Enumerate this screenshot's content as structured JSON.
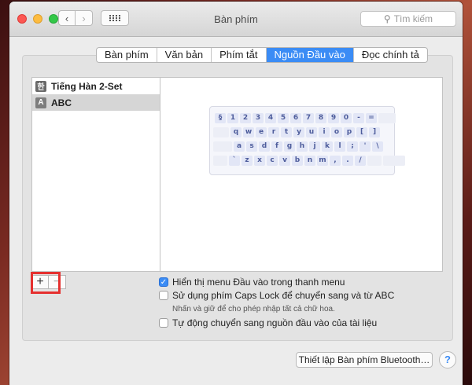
{
  "window": {
    "title": "Bàn phím"
  },
  "toolbar": {
    "back_glyph": "‹",
    "forward_glyph": "›",
    "search_placeholder": "Tìm kiếm"
  },
  "tabs": [
    {
      "label": "Bàn phím"
    },
    {
      "label": "Văn bản"
    },
    {
      "label": "Phím tắt"
    },
    {
      "label": "Nguồn Đầu vào",
      "active": true
    },
    {
      "label": "Đọc chính tả"
    }
  ],
  "sources": [
    {
      "icon_char": "한",
      "label": "Tiếng Hàn 2-Set"
    },
    {
      "icon_char": "A",
      "label": "ABC",
      "selected": true
    }
  ],
  "keyboard": {
    "rows": [
      [
        "§",
        "1",
        "2",
        "3",
        "4",
        "5",
        "6",
        "7",
        "8",
        "9",
        "0",
        "-",
        "=",
        ""
      ],
      [
        "",
        "q",
        "w",
        "e",
        "r",
        "t",
        "y",
        "u",
        "i",
        "o",
        "p",
        "[",
        "]"
      ],
      [
        "",
        "a",
        "s",
        "d",
        "f",
        "g",
        "h",
        "j",
        "k",
        "l",
        ";",
        "'",
        "\\"
      ],
      [
        "",
        "`",
        "z",
        "x",
        "c",
        "v",
        "b",
        "n",
        "m",
        ",",
        ".",
        "/",
        "",
        ""
      ]
    ]
  },
  "buttons": {
    "add": "+",
    "remove": "−",
    "bluetooth": "Thiết lập Bàn phím Bluetooth…",
    "help": "?"
  },
  "options": {
    "show_menu": {
      "label": "Hiển thị menu Đầu vào trong thanh menu",
      "checked": true
    },
    "caps_lock": {
      "label": "Sử dụng phím Caps Lock để chuyển sang và từ ABC",
      "checked": false,
      "hint": "Nhấn và giữ để cho phép nhập tất cả chữ hoa."
    },
    "auto_switch": {
      "label": "Tự động chuyển sang nguồn đầu vào của tài liệu",
      "checked": false
    }
  },
  "colors": {
    "accent": "#3b8cf5",
    "highlight": "#e5302f"
  }
}
